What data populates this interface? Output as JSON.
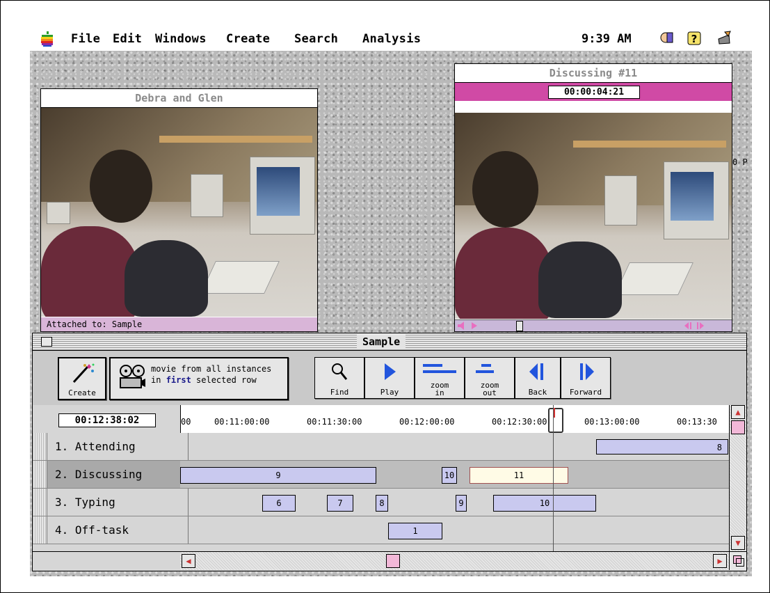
{
  "menubar": {
    "items": [
      "File",
      "Edit",
      "Windows",
      "Create",
      "Search",
      "Analysis"
    ],
    "clock": "9:39 AM",
    "icons": [
      "apple-icon",
      "balloon-help-icon",
      "help-icon",
      "application-icon"
    ]
  },
  "left_video": {
    "title": "Debra and Glen",
    "attached": "Attached to:  Sample"
  },
  "right_video": {
    "title": "Discussing #11",
    "timecode": "00:00:04:21"
  },
  "background_peeks": {
    "text": "0 P"
  },
  "sample": {
    "title": "Sample",
    "toolbar": {
      "create": "Create",
      "movie_line1": "movie from all instances",
      "movie_line2_pre": "in ",
      "movie_line2_bold": "first",
      "movie_line2_post": " selected row",
      "find": "Find",
      "play": "Play",
      "zoom_in_1": "zoom",
      "zoom_in_2": "in",
      "zoom_out_1": "zoom",
      "zoom_out_2": "out",
      "back": "Back",
      "forward": "Forward"
    },
    "current_time": "00:12:38:02",
    "ruler": [
      "00",
      "00:11:00:00",
      "00:11:30:00",
      "00:12:00:00",
      "00:12:30:00",
      "00:13:00:00",
      "00:13:30"
    ],
    "rows": [
      {
        "label": "1. Attending",
        "instances": [
          {
            "n": "8"
          }
        ]
      },
      {
        "label": "2. Discussing",
        "instances": [
          {
            "n": "9"
          },
          {
            "n": "10"
          },
          {
            "n": "11"
          }
        ]
      },
      {
        "label": "3. Typing",
        "instances": [
          {
            "n": "6"
          },
          {
            "n": "7"
          },
          {
            "n": "8"
          },
          {
            "n": "9"
          },
          {
            "n": "10"
          }
        ]
      },
      {
        "label": "4. Off-task",
        "instances": [
          {
            "n": "1"
          }
        ]
      }
    ]
  }
}
